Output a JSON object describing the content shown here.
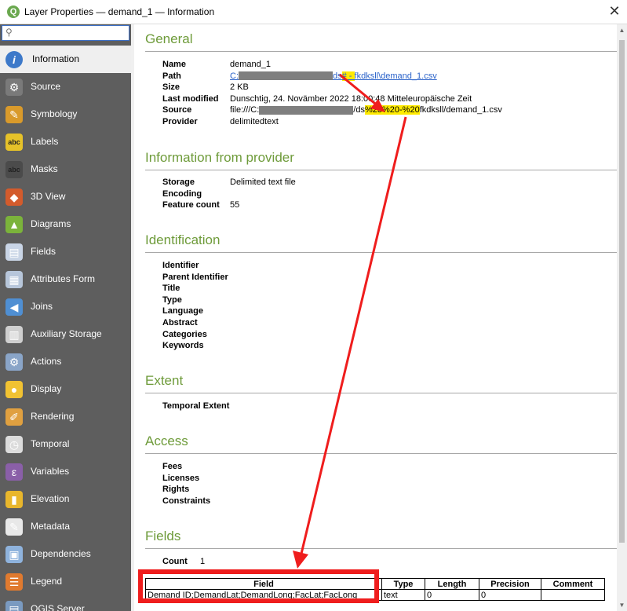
{
  "window": {
    "app_icon": "qgis-icon",
    "title": "Layer Properties — demand_1 — Information",
    "close_glyph": "✕"
  },
  "search": {
    "value": "",
    "placeholder": ""
  },
  "sidebar": {
    "items": [
      {
        "label": "Information",
        "icon": "information-icon",
        "glyph": "i",
        "color": "#3d79c9",
        "active": true
      },
      {
        "label": "Source",
        "icon": "source-icon",
        "glyph": "⚙",
        "color": "#7a7a7a"
      },
      {
        "label": "Symbology",
        "icon": "symbology-icon",
        "glyph": "✎",
        "color": "#d99a2b"
      },
      {
        "label": "Labels",
        "icon": "labels-icon",
        "glyph": "abc",
        "color": "#e6c229"
      },
      {
        "label": "Masks",
        "icon": "masks-icon",
        "glyph": "abc",
        "color": "#4b4b4b"
      },
      {
        "label": "3D View",
        "icon": "3d-view-icon",
        "glyph": "◆",
        "color": "#d35b2c"
      },
      {
        "label": "Diagrams",
        "icon": "diagrams-icon",
        "glyph": "▲",
        "color": "#7bb33b"
      },
      {
        "label": "Fields",
        "icon": "fields-icon",
        "glyph": "▤",
        "color": "#c9d5e6"
      },
      {
        "label": "Attributes Form",
        "icon": "attributes-form-icon",
        "glyph": "▦",
        "color": "#b7c6da"
      },
      {
        "label": "Joins",
        "icon": "joins-icon",
        "glyph": "◀",
        "color": "#4f8fd3"
      },
      {
        "label": "Auxiliary Storage",
        "icon": "auxiliary-storage-icon",
        "glyph": "▥",
        "color": "#cfcfcf"
      },
      {
        "label": "Actions",
        "icon": "actions-icon",
        "glyph": "⚙",
        "color": "#8aa5c8"
      },
      {
        "label": "Display",
        "icon": "display-icon",
        "glyph": "●",
        "color": "#f1c232"
      },
      {
        "label": "Rendering",
        "icon": "rendering-icon",
        "glyph": "✐",
        "color": "#e0a040"
      },
      {
        "label": "Temporal",
        "icon": "temporal-icon",
        "glyph": "◷",
        "color": "#dcdcdc"
      },
      {
        "label": "Variables",
        "icon": "variables-icon",
        "glyph": "ε",
        "color": "#8a5fa8"
      },
      {
        "label": "Elevation",
        "icon": "elevation-icon",
        "glyph": "▮",
        "color": "#e8b62c"
      },
      {
        "label": "Metadata",
        "icon": "metadata-icon",
        "glyph": "✎",
        "color": "#e8e8e8"
      },
      {
        "label": "Dependencies",
        "icon": "dependencies-icon",
        "glyph": "▣",
        "color": "#8fb3dd"
      },
      {
        "label": "Legend",
        "icon": "legend-icon",
        "glyph": "☰",
        "color": "#e07a2f"
      },
      {
        "label": "QGIS Server",
        "icon": "qgis-server-icon",
        "glyph": "▤",
        "color": "#7a9ac0"
      }
    ]
  },
  "general": {
    "heading": "General",
    "name_k": "Name",
    "name_v": "demand_1",
    "path_k": "Path",
    "path_pre": "C:",
    "path_mid": "ds",
    "path_hl": "# - ",
    "path_post": "fkdksll\\demand_1.csv",
    "size_k": "Size",
    "size_v": "2 KB",
    "modified_k": "Last modified",
    "modified_v": "Dunschtig, 24. Novämber 2022 18:00:48 Mitteleuropäische Zeit",
    "source_k": "Source",
    "source_pre": "file:///C:",
    "source_mid": "/ds",
    "source_hl": "%23%20-%20",
    "source_post": "fkdksll/demand_1.csv",
    "provider_k": "Provider",
    "provider_v": "delimitedtext"
  },
  "provider_info": {
    "heading": "Information from provider",
    "storage_k": "Storage",
    "storage_v": "Delimited text file",
    "encoding_k": "Encoding",
    "encoding_v": "",
    "count_k": "Feature count",
    "count_v": "55"
  },
  "identification": {
    "heading": "Identification",
    "labels": [
      "Identifier",
      "Parent Identifier",
      "Title",
      "Type",
      "Language",
      "Abstract",
      "Categories",
      "Keywords"
    ]
  },
  "extent": {
    "heading": "Extent",
    "temporal_k": "Temporal Extent"
  },
  "access": {
    "heading": "Access",
    "labels": [
      "Fees",
      "Licenses",
      "Rights",
      "Constraints"
    ]
  },
  "fields": {
    "heading": "Fields",
    "count_k": "Count",
    "count_v": "1",
    "columns": [
      "Field",
      "Type",
      "Length",
      "Precision",
      "Comment"
    ],
    "row": [
      "Demand ID;DemandLat;DemandLong;FacLat;FacLong",
      "text",
      "0",
      "0",
      ""
    ]
  },
  "annotation_color": "#ef1d1d"
}
